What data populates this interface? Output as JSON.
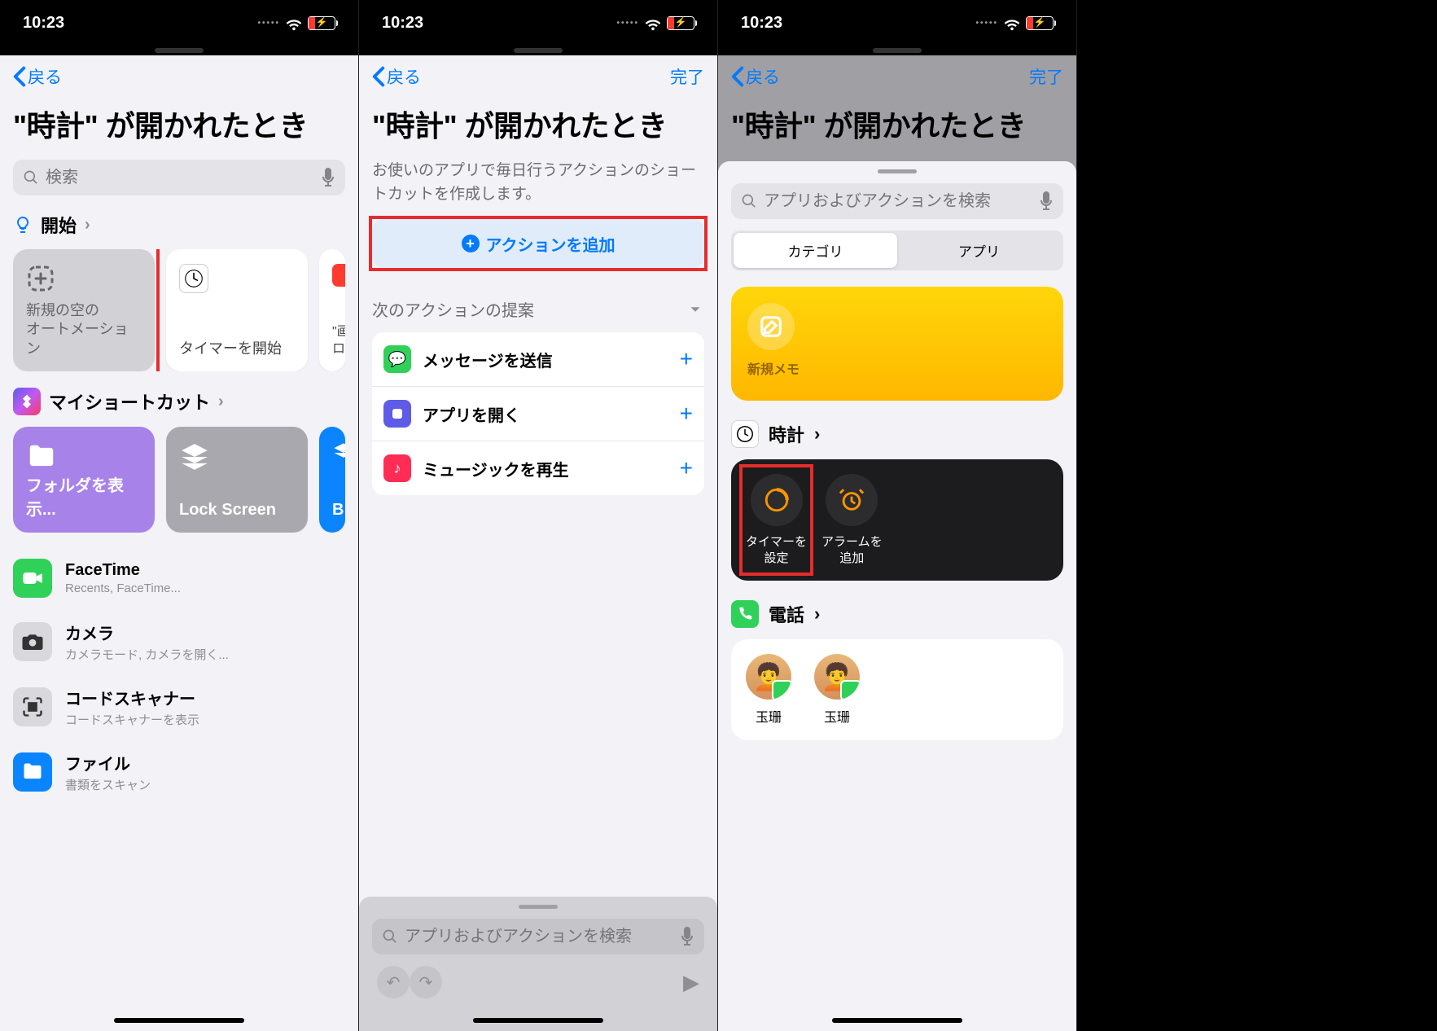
{
  "status": {
    "time": "10:23"
  },
  "nav": {
    "back": "戻る",
    "done": "完了"
  },
  "title": "\"時計\" が開かれたとき",
  "screen1": {
    "search_placeholder": "検索",
    "start_section": "開始",
    "card_new_empty_1": "新規の空の",
    "card_new_empty_2": "オートメーション",
    "card_timer": "タイマーを開始",
    "card_screen_partial_1": "\"画",
    "card_screen_partial_2": "ロ",
    "myshortcuts": "マイショートカット",
    "folder_card": "フォルダを表示...",
    "lock_card": "Lock Screen",
    "blue_card_partial": "B",
    "apps": [
      {
        "name": "FaceTime",
        "sub": "Recents, FaceTime..."
      },
      {
        "name": "カメラ",
        "sub": "カメラモード, カメラを開く..."
      },
      {
        "name": "コードスキャナー",
        "sub": "コードスキャナーを表示"
      },
      {
        "name": "ファイル",
        "sub": "書類をスキャン"
      }
    ]
  },
  "screen2": {
    "desc": "お使いのアプリで毎日行うアクションのショートカットを作成します。",
    "add_action": "アクションを追加",
    "suggest_head": "次のアクションの提案",
    "actions": [
      {
        "label": "メッセージを送信"
      },
      {
        "label": "アプリを開く"
      },
      {
        "label": "ミュージックを再生"
      }
    ],
    "bottom_search": "アプリおよびアクションを検索"
  },
  "screen3": {
    "search_placeholder": "アプリおよびアクションを検索",
    "seg_category": "カテゴリ",
    "seg_app": "アプリ",
    "memo": "新規メモ",
    "clock_head": "時計",
    "timer_label": "タイマーを\n設定",
    "alarm_label": "アラームを\n追加",
    "phone_head": "電話",
    "contact_name": "玉珊"
  }
}
